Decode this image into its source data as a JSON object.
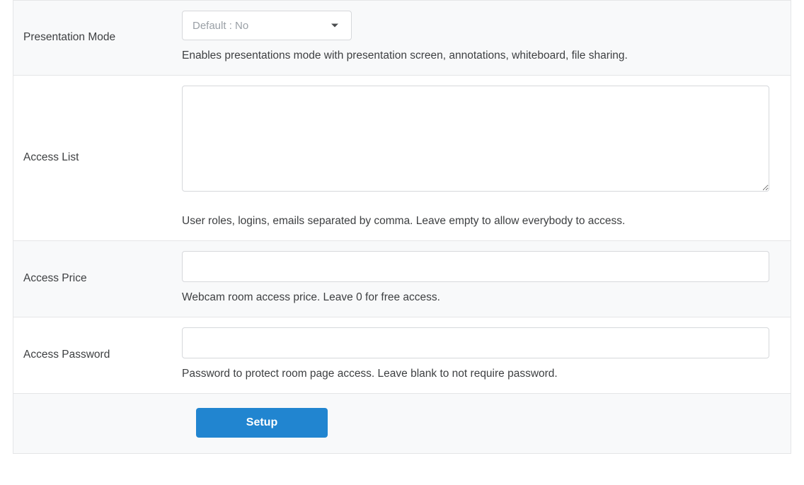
{
  "fields": {
    "presentation_mode": {
      "label": "Presentation Mode",
      "selected": "Default : No",
      "desc": "Enables presentations mode with presentation screen, annotations, whiteboard, file sharing."
    },
    "access_list": {
      "label": "Access List",
      "value": "",
      "desc": "User roles, logins, emails separated by comma. Leave empty to allow everybody to access."
    },
    "access_price": {
      "label": "Access Price",
      "value": "",
      "desc": "Webcam room access price. Leave 0 for free access."
    },
    "access_password": {
      "label": "Access Password",
      "value": "",
      "desc": "Password to protect room page access. Leave blank to not require password."
    }
  },
  "submit_label": "Setup"
}
